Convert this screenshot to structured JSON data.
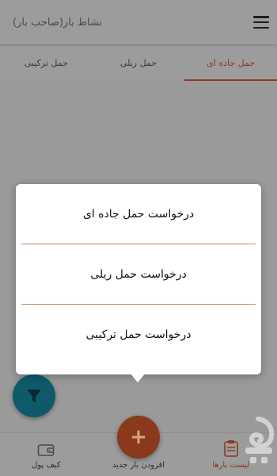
{
  "app_bar": {
    "title": "نشاط بار(صاحب بار)",
    "menu_icon": "hamburger-menu-icon"
  },
  "tabs": [
    {
      "label": "حمل جاده ای",
      "active": true
    },
    {
      "label": "حمل ریلی",
      "active": false
    },
    {
      "label": "حمل ترکیبی",
      "active": false
    }
  ],
  "dialog": {
    "items": [
      "درخواست حمل جاده ای",
      "درخواست حمل ریلی",
      "درخواست حمل ترکیبی"
    ]
  },
  "fab": {
    "filter_icon": "filter-icon",
    "add_icon": "plus-icon",
    "add_symbol": "+"
  },
  "bottom_nav": {
    "items": [
      {
        "label": "لیست بارها",
        "icon": "clipboard-list-icon",
        "active": true
      },
      {
        "label": "افزودن بار جدید",
        "icon": "plus-icon",
        "active": false
      },
      {
        "label": "کیف پول",
        "icon": "wallet-icon",
        "active": false
      }
    ]
  },
  "colors": {
    "accent": "#8a3a1c",
    "filter_fab": "#0f5a6a",
    "dim_background": "#9a9a9a",
    "dialog_separator": "#c28a5e"
  }
}
